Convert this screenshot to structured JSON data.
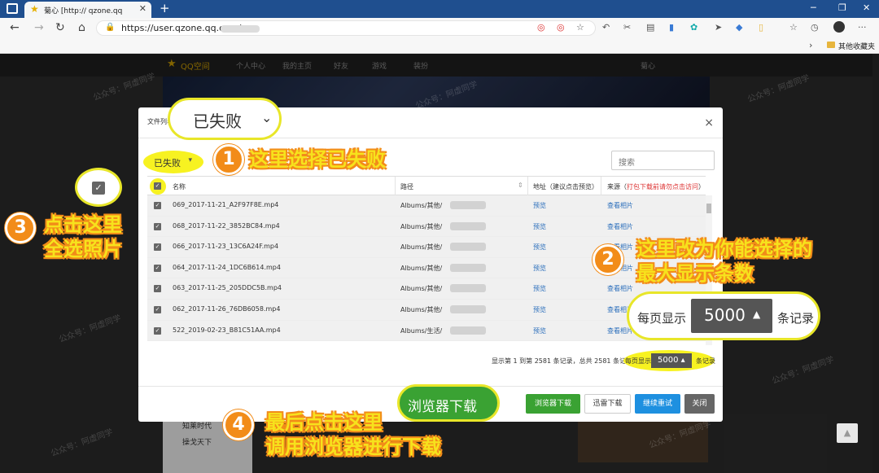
{
  "browser": {
    "tab_title": "菊心 [http://             qzone.qq",
    "tab_close": "✕",
    "new_tab": "+",
    "url": "https://user.qzone.qq.com/",
    "favorites_label": "其他收藏夹"
  },
  "qzone_nav": {
    "brand": "QQ空间",
    "personal": "个人中心",
    "home": "我的主页",
    "friends": "好友",
    "games": "游戏",
    "decor": "装扮",
    "username": "菊心",
    "side_items": [
      "知莱时代",
      "操戈天下"
    ]
  },
  "dialog": {
    "title": "文件列表",
    "close": "×",
    "filter_value": "已失败",
    "search_placeholder": "搜索",
    "columns": {
      "name": "名称",
      "path": "路径",
      "address": "地址（建议点击预览）",
      "source_prefix": "来源（",
      "source_hint": "打包下载前请勿点击访问",
      "source_suffix": "）"
    },
    "rows": [
      {
        "name": "069_2017-11-21_A2F97F8E.mp4",
        "path": "Albums/其他/",
        "addr": "预览",
        "src": "查看相片"
      },
      {
        "name": "068_2017-11-22_3852BC84.mp4",
        "path": "Albums/其他/",
        "addr": "预览",
        "src": "查看相片"
      },
      {
        "name": "066_2017-11-23_13C6A24F.mp4",
        "path": "Albums/其他/",
        "addr": "预览",
        "src": "查看相片"
      },
      {
        "name": "064_2017-11-24_1DC6B614.mp4",
        "path": "Albums/其他/",
        "addr": "预览",
        "src": "查看相片"
      },
      {
        "name": "063_2017-11-25_205DDC5B.mp4",
        "path": "Albums/其他/",
        "addr": "预览",
        "src": "查看相片"
      },
      {
        "name": "062_2017-11-26_76DB6058.mp4",
        "path": "Albums/其他/",
        "addr": "预览",
        "src": "查看相片"
      },
      {
        "name": "522_2019-02-23_B81C51AA.mp4",
        "path": "Albums/生活/",
        "addr": "预览",
        "src": "查看相片"
      }
    ],
    "pager_text": "显示第 1 到第 2581 条记录，总共 2581 条记录",
    "per_page_prefix": "每页显示",
    "per_page_value": "5000",
    "per_page_suffix": "条记录",
    "buttons": {
      "browser_download": "浏览器下载",
      "xunlei_download": "迅雷下载",
      "retry": "继续重试",
      "close": "关闭"
    }
  },
  "annotations": {
    "bubble_filter": "已失败",
    "step1_num": "1",
    "step1_text": "这里选择已失败",
    "step2_num": "2",
    "step2_line1": "这里改为你能选择的",
    "step2_line2": "最大显示条数",
    "bubble_perpage_prefix": "每页显示",
    "bubble_perpage_value": "5000",
    "bubble_perpage_suffix": "条记录",
    "step3_num": "3",
    "step3_line1": "点击这里",
    "step3_line2": "全选照片",
    "step4_num": "4",
    "step4_line1": "最后点击这里",
    "step4_line2": "调用浏览器进行下载",
    "bubble_browser": "浏览器下载",
    "watermark": "公众号：阿虚同学"
  },
  "colors": {
    "annotation_yellow": "#f7f221",
    "annotation_orange": "#f28c19",
    "download_green": "#3aa233",
    "retry_blue": "#1e90e0",
    "browser_blue": "#1f4f8f"
  }
}
